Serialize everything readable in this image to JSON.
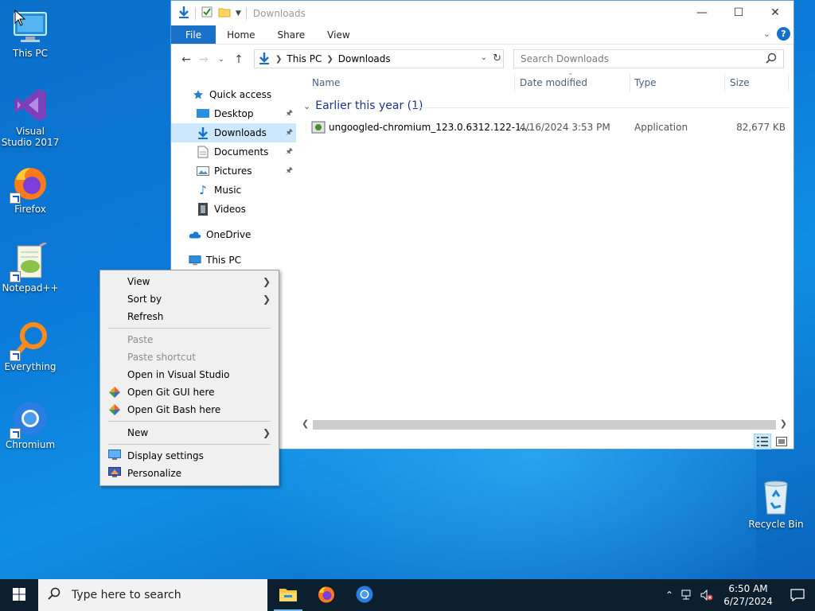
{
  "desktop": {
    "icons": [
      {
        "label": "This PC",
        "icon": "this-pc-icon"
      },
      {
        "label": "Visual Studio 2017",
        "icon": "visual-studio-icon"
      },
      {
        "label": "Firefox",
        "icon": "firefox-icon"
      },
      {
        "label": "Notepad++",
        "icon": "notepadpp-icon"
      },
      {
        "label": "Everything",
        "icon": "everything-icon"
      },
      {
        "label": "Chromium",
        "icon": "chromium-icon"
      },
      {
        "label": "Recycle Bin",
        "icon": "recycle-bin-icon"
      }
    ]
  },
  "explorer": {
    "title": "Downloads",
    "ribbon_tabs": [
      "File",
      "Home",
      "Share",
      "View"
    ],
    "address": {
      "root": "This PC",
      "current": "Downloads"
    },
    "search_placeholder": "Search Downloads",
    "nav": {
      "quick_access": "Quick access",
      "items": [
        {
          "label": "Desktop",
          "pinned": true
        },
        {
          "label": "Downloads",
          "pinned": true,
          "selected": true
        },
        {
          "label": "Documents",
          "pinned": true
        },
        {
          "label": "Pictures",
          "pinned": true
        },
        {
          "label": "Music",
          "pinned": false
        },
        {
          "label": "Videos",
          "pinned": false
        }
      ],
      "onedrive": "OneDrive",
      "this_pc": "This PC"
    },
    "columns": {
      "name": "Name",
      "date": "Date modified",
      "type": "Type",
      "size": "Size"
    },
    "group": "Earlier this year (1)",
    "files": [
      {
        "name": "ungoogled-chromium_123.0.6312.122-1....",
        "date": "4/16/2024 3:53 PM",
        "type": "Application",
        "size": "82,677 KB"
      }
    ]
  },
  "context_menu": {
    "view": "View",
    "sort_by": "Sort by",
    "refresh": "Refresh",
    "paste": "Paste",
    "paste_shortcut": "Paste shortcut",
    "open_vs": "Open in Visual Studio",
    "git_gui": "Open Git GUI here",
    "git_bash": "Open Git Bash here",
    "new": "New",
    "display_settings": "Display settings",
    "personalize": "Personalize"
  },
  "taskbar": {
    "search_placeholder": "Type here to search",
    "time": "6:50 AM",
    "date": "6/27/2024"
  },
  "colors": {
    "accent": "#1a6fc8",
    "selection": "#cce8ff",
    "taskbar": "#0b1f2f"
  }
}
